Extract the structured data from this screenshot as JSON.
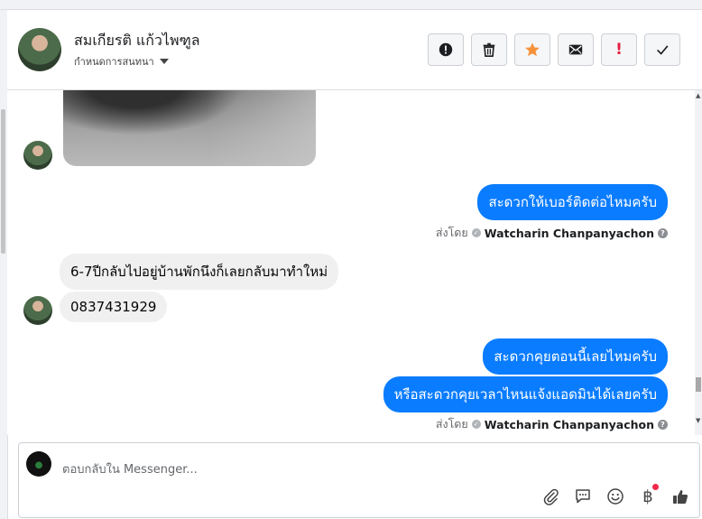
{
  "header": {
    "contact_name": "สมเกียรติ แก้วไพฑูล",
    "assign_label": "กำหนดการสนทนา",
    "actions": [
      "report-icon",
      "trash-icon",
      "star-icon",
      "envelope-icon",
      "spam-icon",
      "check-icon"
    ]
  },
  "messages": {
    "out1": "สะดวกให้เบอร์ติดต่อไหมครับ",
    "in1": "6-7ปีกลับไปอยู่บ้านพักนึงก็เลยกลับมาทำใหม่",
    "in2": "0837431929",
    "out2": "สะดวกคุยตอนนี้เลยไหมครับ",
    "out3": "หรือสะดวกคุยเวลาไหนแจ้งแอดมินได้เลยครับ"
  },
  "sent_by": {
    "prefix": "ส่งโดย",
    "agent": "Watcharin Chanpanyachon"
  },
  "composer": {
    "placeholder": "ตอบกลับใน Messenger...",
    "tools": [
      "paperclip-icon",
      "chat-bubble-icon",
      "smiley-icon",
      "baht-icon",
      "thumbs-up-icon"
    ],
    "baht_symbol": "฿"
  },
  "colors": {
    "outgoing_bubble": "#0a7cff",
    "incoming_bubble": "#f0f0f0",
    "star": "#f7923a",
    "spam": "#e41e3f"
  }
}
